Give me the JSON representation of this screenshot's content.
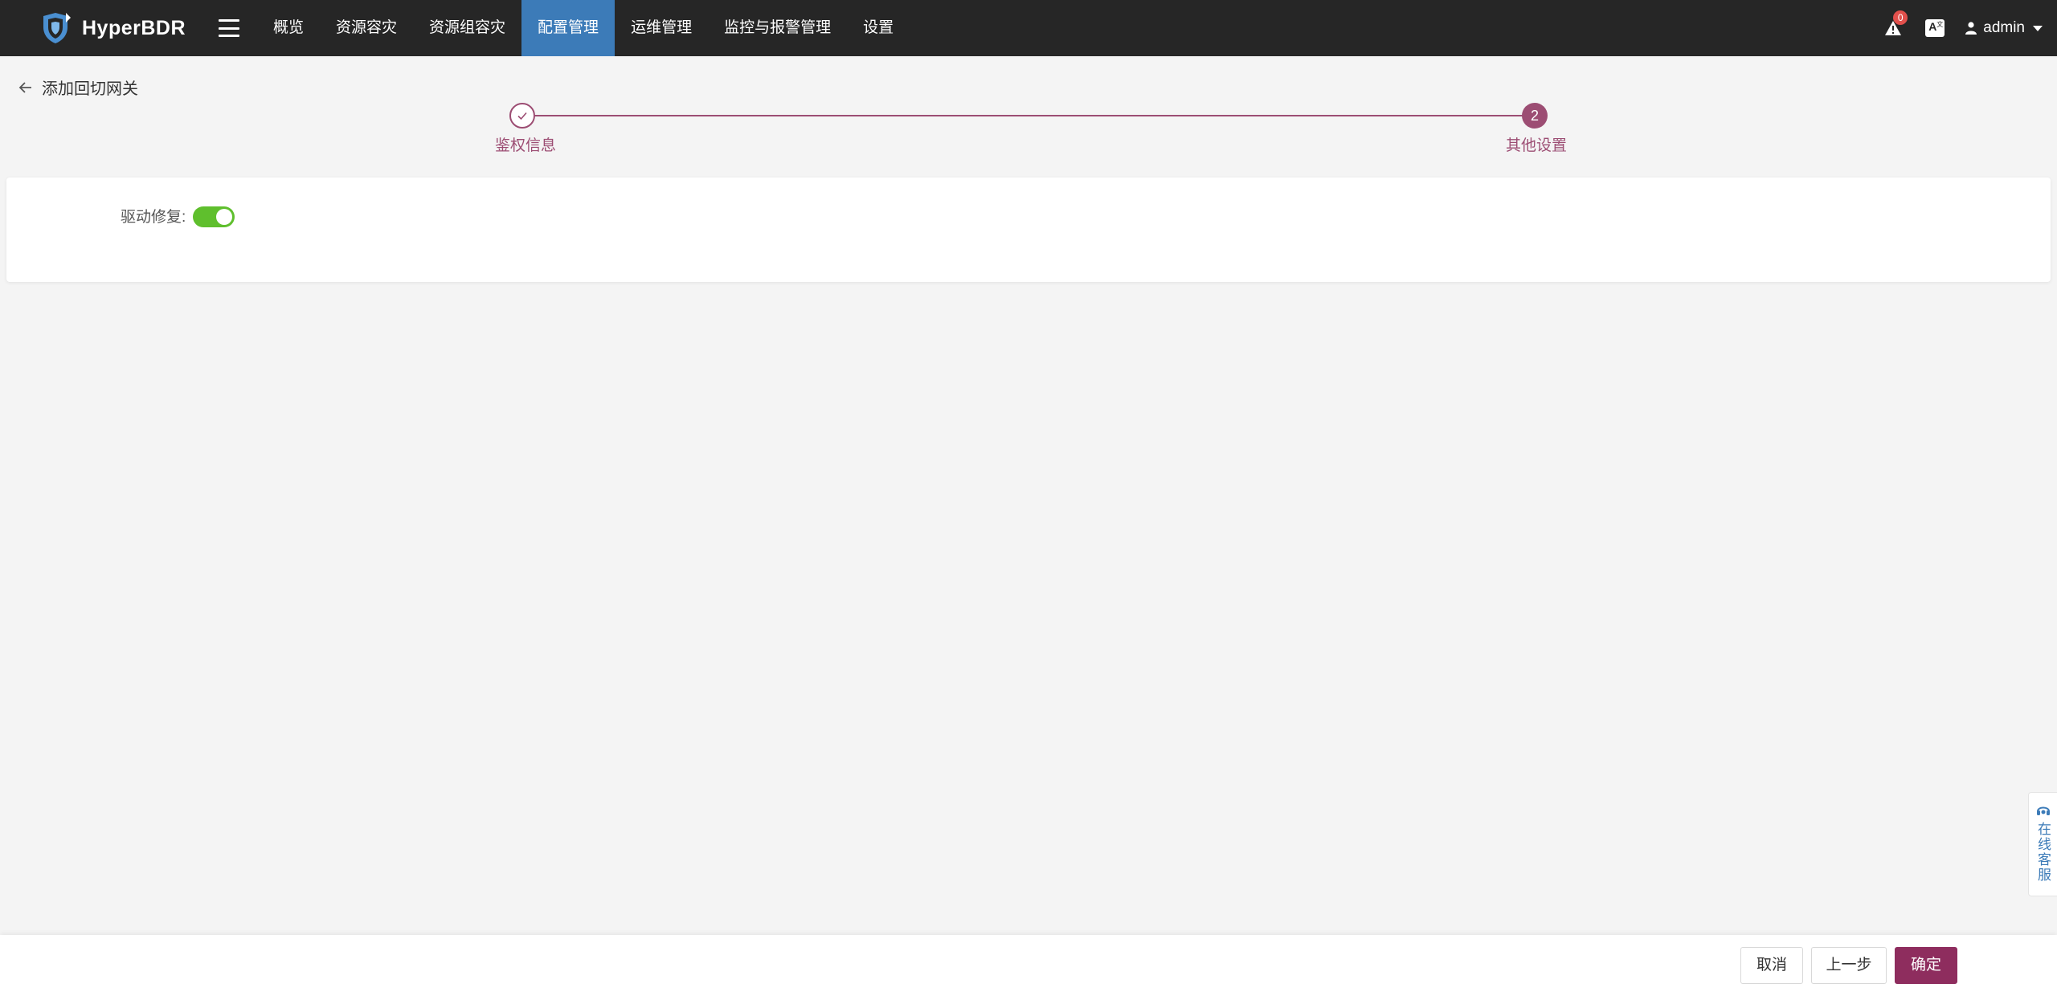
{
  "app": {
    "name": "HyperBDR"
  },
  "nav": {
    "items": [
      {
        "label": "概览"
      },
      {
        "label": "资源容灾"
      },
      {
        "label": "资源组容灾"
      },
      {
        "label": "配置管理",
        "active": true
      },
      {
        "label": "运维管理"
      },
      {
        "label": "监控与报警管理"
      },
      {
        "label": "设置"
      }
    ]
  },
  "header": {
    "alert_count": "0",
    "lang_icon": "A",
    "user": "admin"
  },
  "page": {
    "title": "添加回切网关"
  },
  "steps": [
    {
      "label": "鉴权信息",
      "status": "done"
    },
    {
      "label": "其他设置",
      "number": "2",
      "status": "active"
    }
  ],
  "form": {
    "driver_repair_label": "驱动修复:",
    "driver_repair_enabled": true
  },
  "support": {
    "label": "在线客服"
  },
  "footer": {
    "cancel_label": "取消",
    "prev_label": "上一步",
    "confirm_label": "确定"
  },
  "colors": {
    "topbar": "#262626",
    "nav_active": "#3c7bb8",
    "accent": "#9c4d73",
    "confirm": "#8e2d5e",
    "toggle_on": "#5fbf2d"
  }
}
